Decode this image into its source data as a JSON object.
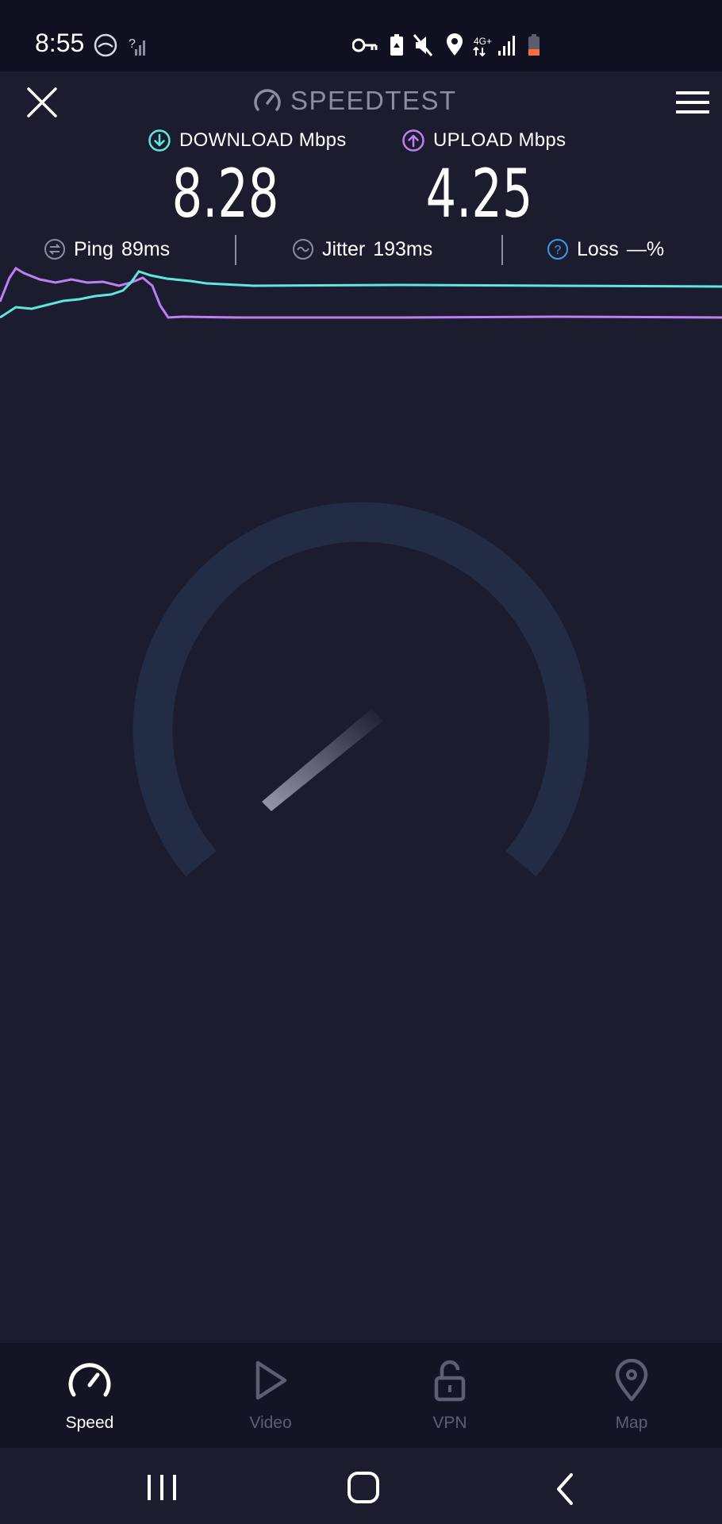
{
  "status_bar": {
    "time": "8:55",
    "icons_left": [
      "weather-icon",
      "no-signal-icon"
    ],
    "icons_right": [
      "vpn-key-icon",
      "battery-saver-icon",
      "mute-icon",
      "location-icon",
      "network-4g-icon",
      "signal-icon",
      "battery-icon"
    ],
    "network_label": "4G+"
  },
  "header": {
    "title": "SPEEDTEST"
  },
  "download": {
    "label": "DOWNLOAD Mbps",
    "value": "8.28",
    "color": "#5ee8dd"
  },
  "upload": {
    "label": "UPLOAD Mbps",
    "value": "4.25",
    "color": "#c07ef5"
  },
  "stats": {
    "ping_label": "Ping",
    "ping_value": "89ms",
    "jitter_label": "Jitter",
    "jitter_value": "193ms",
    "loss_label": "Loss",
    "loss_value": "—%"
  },
  "nav": [
    {
      "label": "Speed",
      "icon": "speed-icon",
      "active": true
    },
    {
      "label": "Video",
      "icon": "play-icon",
      "active": false
    },
    {
      "label": "VPN",
      "icon": "lock-icon",
      "active": false
    },
    {
      "label": "Map",
      "icon": "map-pin-icon",
      "active": false
    }
  ],
  "colors": {
    "background": "#1b1c2e",
    "gauge_track": "#222c45",
    "accent_download": "#5ee8dd",
    "accent_upload": "#c07ef5"
  }
}
